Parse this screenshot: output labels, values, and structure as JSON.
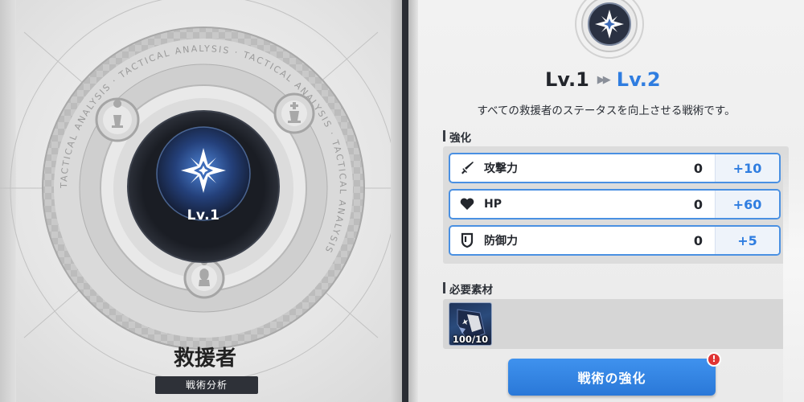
{
  "left": {
    "ring_text": "TACTICAL ANALYSIS",
    "emblem_level": "Lv.1",
    "name": "救援者",
    "subtitle": "戦術分析"
  },
  "right": {
    "level_current": "Lv.1",
    "level_arrow": "▶▶",
    "level_next": "Lv.2",
    "description": "すべての救援者のステータスを向上させる戦術です。",
    "enhance_section_title": "強化",
    "stats": [
      {
        "icon": "sword-icon",
        "label": "攻撃力",
        "base": "0",
        "bonus": "+10"
      },
      {
        "icon": "heart-icon",
        "label": "HP",
        "base": "0",
        "bonus": "+60"
      },
      {
        "icon": "shield-icon",
        "label": "防御力",
        "base": "0",
        "bonus": "+5"
      }
    ],
    "materials_section_title": "必要素材",
    "material": {
      "icon": "tactical-material-icon",
      "count": "100/10"
    },
    "enhance_button": "戦術の強化",
    "alert_badge": "!"
  },
  "colors": {
    "accent_blue": "#2f7de0",
    "button_blue": "#3a8ae6",
    "alert_red": "#e03434",
    "dark_label": "#2e3138"
  }
}
